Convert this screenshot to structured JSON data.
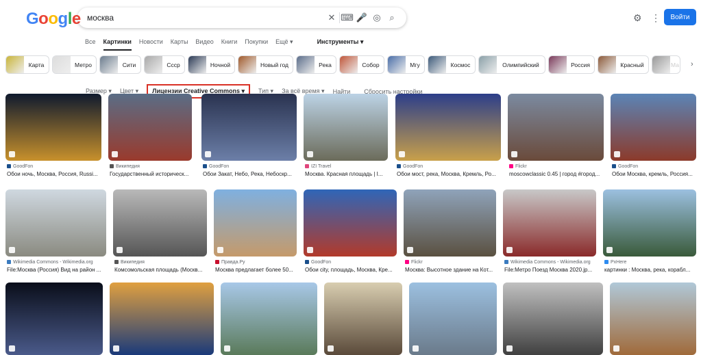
{
  "header": {
    "logo": "Google",
    "query": "москва",
    "login": "Войти"
  },
  "tabs": [
    "Все",
    "Картинки",
    "Новости",
    "Карты",
    "Видео",
    "Книги",
    "Покупки",
    "Ещё ▾"
  ],
  "tools": "Инструменты ▾",
  "chips": [
    "Карта",
    "Метро",
    "Сити",
    "Ссср",
    "Ночной",
    "Новый год",
    "Река",
    "Собор",
    "Мгу",
    "Космос",
    "Олимпийский",
    "Россия",
    "Красный",
    "Ма"
  ],
  "filters": {
    "size": "Размер ▾",
    "color": "Цвет ▾",
    "license": "Лицензии Creative Commons ▾",
    "type": "Тип ▾",
    "time": "За всё время ▾",
    "find": "Найти",
    "reset": "Сбросить настройки"
  },
  "results": [
    {
      "source": "GoodFon",
      "title": "Обои ночь, Москва, Россия, Russi...",
      "sc": "#1a4f8b"
    },
    {
      "source": "Википедия",
      "title": "Государственный историческ...",
      "sc": "#555"
    },
    {
      "source": "GoodFon",
      "title": "Обои Закат, Небо, Река, Небоскр...",
      "sc": "#1a4f8b"
    },
    {
      "source": "IZI Travel",
      "title": "Москва. Красная площадь | I...",
      "sc": "#e0457b"
    },
    {
      "source": "GoodFon",
      "title": "Обои мост, река, Москва, Кремль, Ро...",
      "sc": "#1a4f8b"
    },
    {
      "source": "Flickr",
      "title": "moscowclassic 0.45 | город #город...",
      "sc": "#ff0084"
    },
    {
      "source": "GoodFon",
      "title": "Обои Москва, кремль, Россия...",
      "sc": "#1a4f8b"
    },
    {
      "source": "Wikimedia Commons - Wikimedia.org",
      "title": "File:Москва (Россия) Вид на район ...",
      "sc": "#3a7bbf"
    },
    {
      "source": "Википедия",
      "title": "Комсомольская площадь (Москв...",
      "sc": "#555"
    },
    {
      "source": "Правда.Ру",
      "title": "Москва предлагает более 50...",
      "sc": "#c8102e"
    },
    {
      "source": "GoodFon",
      "title": "Обои city, площадь, Москва, Кре...",
      "sc": "#1a4f8b"
    },
    {
      "source": "Flickr",
      "title": "Москва: Высотное здание на Кот...",
      "sc": "#ff0084"
    },
    {
      "source": "Wikimedia Commons - Wikimedia.org",
      "title": "File:Метро Поезд Москва 2020.jp...",
      "sc": "#3a7bbf"
    },
    {
      "source": "PxHere",
      "title": "картинки : Москва, река, корабл...",
      "sc": "#2d8cf0"
    }
  ]
}
